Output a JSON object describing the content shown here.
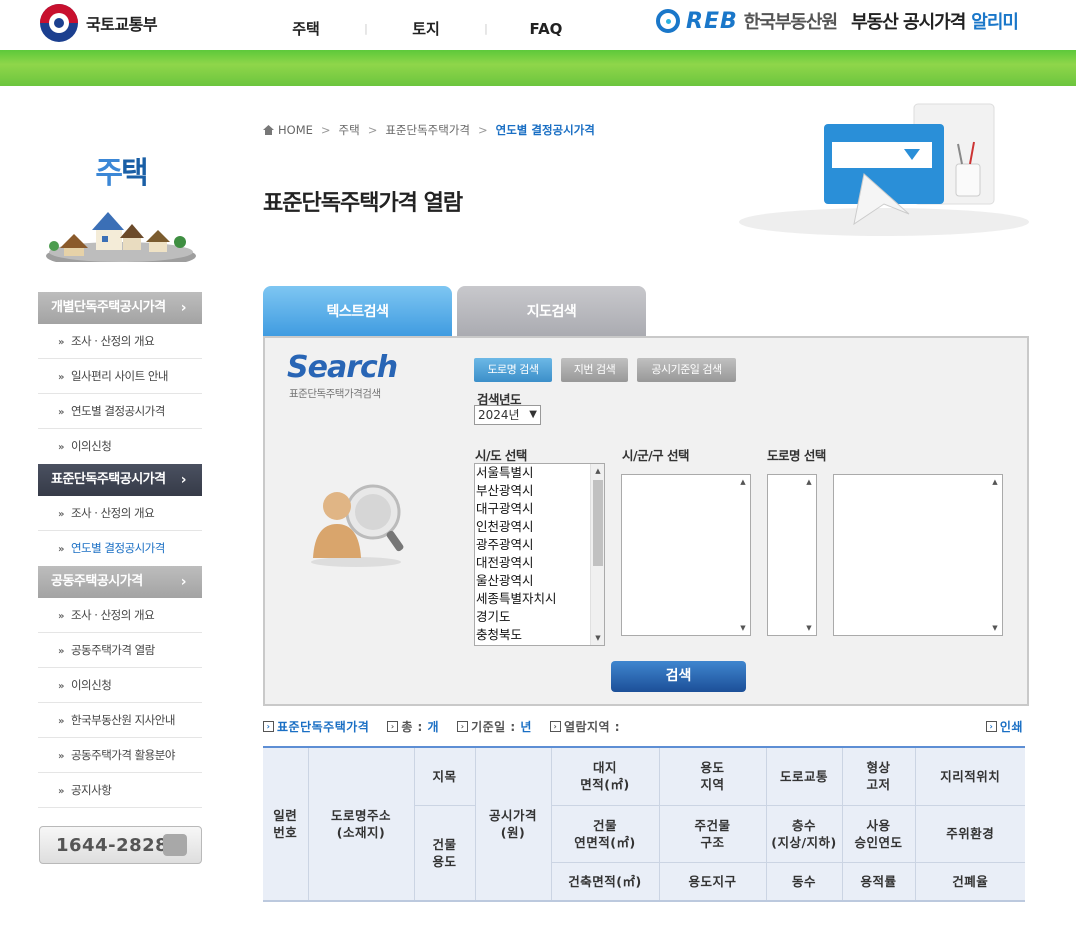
{
  "header": {
    "ministry": "국토교통부",
    "nav": [
      "주택",
      "토지",
      "FAQ"
    ],
    "nav_sep": "|",
    "reb_logo": "REB",
    "reb_name": "한국부동산원",
    "service_name": "부동산 공시가격",
    "service_name_accent": "알리미"
  },
  "sidebar": {
    "title_char1": "주",
    "title_char2": "택",
    "groups": [
      {
        "label": "개별단독주택공시가격",
        "arrow": "›",
        "items": [
          "조사 · 산정의 개요",
          "일사편리 사이트 안내",
          "연도별 결정공시가격",
          "이의신청"
        ]
      },
      {
        "label": "표준단독주택공시가격",
        "arrow": "›",
        "items": [
          "조사 · 산정의 개요",
          "연도별 결정공시가격"
        ]
      },
      {
        "label": "공동주택공시가격",
        "arrow": "›",
        "items": [
          "조사 · 산정의 개요",
          "공동주택가격 열람",
          "이의신청",
          "한국부동산원 지사안내",
          "공동주택가격 활용분야",
          "공지사항"
        ]
      }
    ],
    "bullet": "»",
    "phone": "1644-2828"
  },
  "breadcrumb": [
    "HOME",
    "주택",
    "표준단독주택가격",
    "연도별 결정공시가격"
  ],
  "page_title": "표준단독주택가격 열람",
  "tabs": [
    "텍스트검색",
    "지도검색"
  ],
  "search": {
    "brand": "Search",
    "brand_sub": "표준단독주택가격검색",
    "mode_buttons": [
      "도로명 검색",
      "지번 검색",
      "공시기준일 검색"
    ],
    "year_label": "검색년도",
    "year_value": "2024년",
    "sido_label": "시/도 선택",
    "sigungu_label": "시/군/구 선택",
    "road_label": "도로명 선택",
    "sido_options": [
      "서울특별시",
      "부산광역시",
      "대구광역시",
      "인천광역시",
      "광주광역시",
      "대전광역시",
      "울산광역시",
      "세종특별자치시",
      "경기도",
      "충청북도"
    ],
    "submit": "검색"
  },
  "summary": {
    "category": "표준단독주택가격",
    "total_label": "총 :",
    "total_unit": "개",
    "base_label": "기준일 :",
    "base_unit": "년",
    "region_label": "열람지역 :",
    "print": "인쇄"
  },
  "table": {
    "serial": "일련\n번호",
    "address": "도로명주소\n(소재지)",
    "jimok": "지목",
    "bldg_use": "건물\n용도",
    "price": "공시가격\n(원)",
    "land_area": "대지\n면적(㎡)",
    "zone": "용도\n지역",
    "road": "도로교통",
    "shape": "형상\n고저",
    "location": "지리적위치",
    "bldg_area": "건물\n연면적(㎡)",
    "structure": "주건물\n구조",
    "floors": "층수\n(지상/지하)",
    "approval": "사용\n승인연도",
    "environment": "주위환경",
    "footprint": "건축면적(㎡)",
    "district": "용도지구",
    "count": "동수",
    "far": "용적률",
    "bcr": "건폐율"
  }
}
